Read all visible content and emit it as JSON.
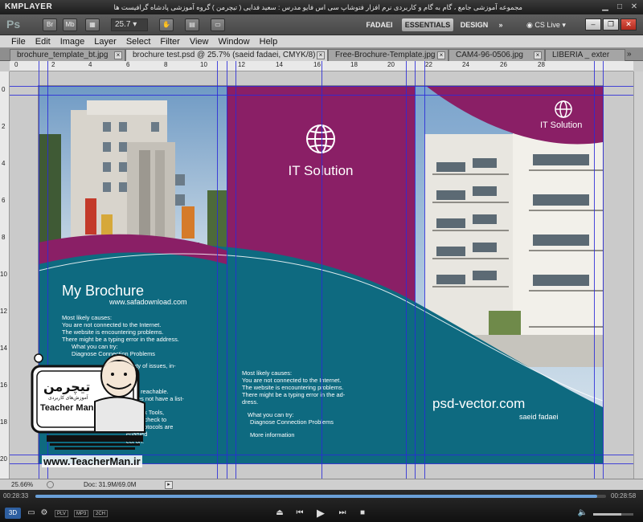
{
  "player": {
    "name": "KMPLAYER",
    "caption": "مجموعه آموزشی جامع ، گام به گام و کاربردی نرم افزار فتوشاپ سی اس فایو   مدرس : سعید فدایی ( تیچرمن ) گروه آموزشی پادشاه گرافیست ها",
    "time_elapsed": "00:28:33",
    "time_total": "00:28:58",
    "progress": 0.985,
    "volume": 0.7,
    "tags": [
      "PLV",
      "MP3",
      "2CH"
    ],
    "mode_3d": "3D",
    "icons": [
      "minimize-icon",
      "maximize-icon",
      "close-icon"
    ]
  },
  "photoshop": {
    "logo": "Ps",
    "bridge": "Br",
    "minibridge": "Mb",
    "zoom": "25.7",
    "workspaces": [
      "FADAEI",
      "ESSENTIALS",
      "DESIGN"
    ],
    "active_workspace": "ESSENTIALS",
    "cslive": "CS Live",
    "menu": [
      "File",
      "Edit",
      "Image",
      "Layer",
      "Select",
      "Filter",
      "View",
      "Window",
      "Help"
    ],
    "tabs": [
      {
        "label": "brochure_template_bt.jpg",
        "active": false
      },
      {
        "label": "brochure test.psd @ 25.7% (saeid fadaei, CMYK/8) *",
        "active": true
      },
      {
        "label": "Free-Brochure-Template.jpg",
        "active": false
      },
      {
        "label": "CAM4-96-0506.jpg",
        "active": false
      },
      {
        "label": "LIBERIA _ exter",
        "active": false
      }
    ],
    "ruler_h": [
      "0",
      "2",
      "4",
      "6",
      "8",
      "10",
      "12",
      "14",
      "16",
      "18",
      "20",
      "22",
      "24",
      "26",
      "28"
    ],
    "ruler_v": [
      "0",
      "2",
      "4",
      "6",
      "8",
      "10",
      "12",
      "14",
      "16",
      "18",
      "20"
    ],
    "status": {
      "zoom": "25.66%",
      "doc": "Doc: 31.9M/69.0M"
    }
  },
  "brochure": {
    "colors": {
      "purple": "#8a1f66",
      "teal": "#0e6a80",
      "white": "#ffffff"
    },
    "globe_icon": "globe-icon",
    "center_title": "IT Solution",
    "right_title": "IT Solution",
    "left_title": "My Brochure",
    "left_url": "www.safadownload.com",
    "left_lines": [
      "Most likely causes:",
      "You are not connected to the Internet.",
      "The website is encountering problems.",
      "There might be a typing error in the address.",
      "What you can try:",
      "Diagnose Connection Problems",
      "ariety of issues, in-",
      "able.",
      "s not reachable.",
      "s does not have a list-",
      "ss, click Tools,",
      "d, and check to",
      "TLS protocols are enabled",
      "ect on."
    ],
    "center_lines": [
      "Most likely causes:",
      "You are not connected to the Internet.",
      "The website is encountering problems.",
      "There might be a typing error in the ad-",
      "dress.",
      "What you can try:",
      "Diagnose Connection Problems",
      "More information"
    ],
    "right_site": "psd-vector.com",
    "right_author": "saeid fadaei"
  },
  "watermark": {
    "url": "www.TeacherMan.ir",
    "name_fa": "تیچرمن",
    "subtitle_fa": "آموزش‌های کاربردی",
    "name_en": "Teacher Man"
  }
}
